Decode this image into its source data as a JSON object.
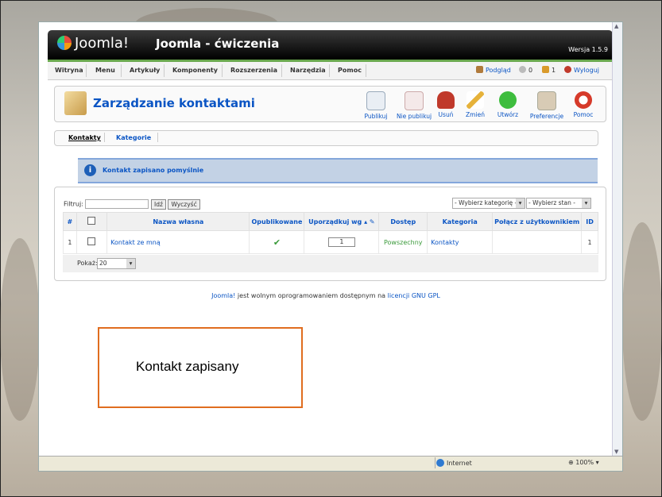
{
  "header": {
    "logo_text": "Joomla!",
    "site_name": "Joomla - ćwiczenia",
    "version": "Wersja 1.5.9"
  },
  "menu": {
    "items": [
      "Witryna",
      "Menu",
      "Artykuły",
      "Komponenty",
      "Rozszerzenia",
      "Narzędzia",
      "Pomoc"
    ],
    "right": {
      "preview": "Podgląd",
      "messages": "0",
      "users": "1",
      "logout": "Wyloguj"
    }
  },
  "toolbar": {
    "title": "Zarządzanie kontaktami",
    "buttons": [
      "Publikuj",
      "Nie publikuj",
      "Usuń",
      "Zmień",
      "Utwórz",
      "Preferencje",
      "Pomoc"
    ]
  },
  "subnav": {
    "tabs": [
      "Kontakty",
      "Kategorie"
    ]
  },
  "message": "Kontakt zapisano pomyślnie",
  "filter": {
    "label": "Filtruj:",
    "go": "Idź",
    "clear": "Wyczyść",
    "category_select": "- Wybierz kategorię -",
    "state_select": "- Wybierz stan -"
  },
  "table": {
    "headers": [
      "#",
      "",
      "Nazwa własna",
      "Opublikowane",
      "Uporządkuj wg",
      "Dostęp",
      "Kategoria",
      "Połącz z użytkownikiem",
      "ID"
    ],
    "rows": [
      {
        "num": "1",
        "name": "Kontakt ze mną",
        "order": "1",
        "access": "Powszechny",
        "category": "Kontakty",
        "linked_user": "",
        "id": "1"
      }
    ]
  },
  "pagination": {
    "label": "Pokaż:",
    "value": "20"
  },
  "footer": {
    "joomla": "Joomla!",
    "text": " jest wolnym oprogramowaniem dostępnym na ",
    "license": "licencji GNU GPL"
  },
  "statusbar": {
    "zone": "Internet",
    "zoom": "100%"
  },
  "annotation": "Kontakt zapisany"
}
